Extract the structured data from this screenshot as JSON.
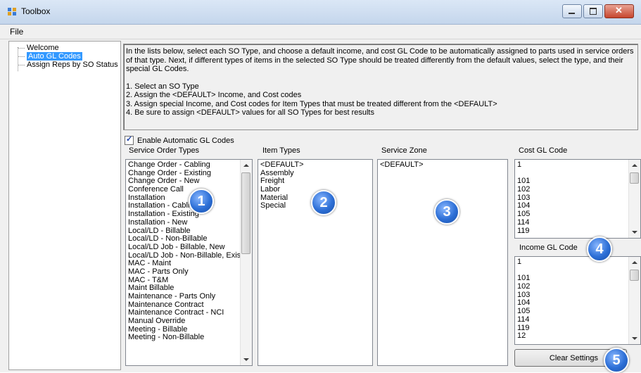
{
  "window": {
    "title": "Toolbox"
  },
  "menu": {
    "file": "File"
  },
  "tree": {
    "items": [
      "Welcome",
      "Auto GL Codes",
      "Assign Reps by SO Status"
    ]
  },
  "instructions": {
    "paragraph": "In the lists below, select each SO Type, and choose a default income, and cost GL Code to be automatically assigned to parts used in service orders of that type. Next, if different types of items in the selected SO Type should be treated differently from the default values, select the type, and their special GL Codes.",
    "steps": [
      "1. Select an SO Type",
      "2. Assign the <DEFAULT> Income, and Cost codes",
      "3. Assign special Income, and Cost codes for Item Types that must be treated different from the <DEFAULT>",
      "4. Be sure to assign <DEFAULT> values for all SO Types for best results"
    ]
  },
  "enable_checkbox": {
    "label": "Enable Automatic GL Codes",
    "checked": true
  },
  "groups": {
    "so_types": {
      "label": "Service Order Types",
      "items": [
        "Change Order - Cabling",
        "Change Order - Existing",
        "Change Order - New",
        "Conference Call",
        "Installation",
        "Installation - Cabling",
        "Installation - Existing",
        "Installation - New",
        "Local/LD - Billable",
        "Local/LD - Non-Billable",
        "Local/LD Job - Billable, New",
        "Local/LD Job - Non-Billable, Exis",
        "MAC - Maint",
        "MAC - Parts Only",
        "MAC - T&M",
        "Maint Billable",
        "Maintenance - Parts Only",
        "Maintenance Contract",
        "Maintenance Contract - NCI",
        "Manual Override",
        "Meeting - Billable",
        "Meeting - Non-Billable"
      ]
    },
    "item_types": {
      "label": "Item Types",
      "items": [
        "<DEFAULT>",
        "Assembly",
        "Freight",
        "Labor",
        "Material",
        "Special"
      ]
    },
    "service_zone": {
      "label": "Service Zone",
      "items": [
        "<DEFAULT>"
      ]
    },
    "cost_gl": {
      "label": "Cost GL Code",
      "items": [
        "1",
        "",
        "101",
        "102",
        "103",
        "104",
        "105",
        "114",
        "119"
      ]
    },
    "income_gl": {
      "label": "Income GL Code",
      "items": [
        "1",
        "",
        "101",
        "102",
        "103",
        "104",
        "105",
        "114",
        "119",
        "12"
      ]
    }
  },
  "badges": [
    "1",
    "2",
    "3",
    "4",
    "5"
  ],
  "buttons": {
    "clear_settings": "Clear Settings"
  }
}
